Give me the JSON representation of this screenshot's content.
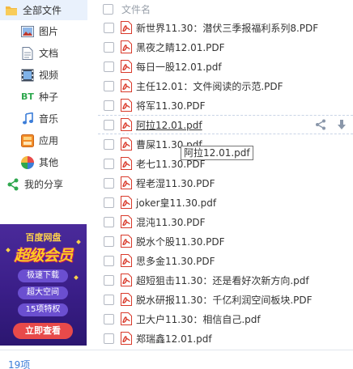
{
  "sidebar": {
    "all_files": "全部文件",
    "items": [
      {
        "label": "图片",
        "icon": "image-icon"
      },
      {
        "label": "文档",
        "icon": "document-icon"
      },
      {
        "label": "视频",
        "icon": "video-icon"
      },
      {
        "label": "种子",
        "icon": "bt-icon",
        "icon_text": "BT"
      },
      {
        "label": "音乐",
        "icon": "music-icon"
      },
      {
        "label": "应用",
        "icon": "app-icon"
      },
      {
        "label": "其他",
        "icon": "other-icon"
      }
    ],
    "share": "我的分享"
  },
  "banner": {
    "title": "百度网盘",
    "headline": "超级会员",
    "features": [
      "极速下载",
      "超大空间",
      "15项特权"
    ],
    "cta": "立即查看"
  },
  "list_header": {
    "column_label": "文件名"
  },
  "files": [
    "新世界11.30：潜伏三季报福利系列8.PDF",
    "黑夜之睛12.01.PDF",
    "每日一股12.01.pdf",
    "主任12.01：文件阅读的示范.PDF",
    "将军11.30.PDF",
    "阿拉12.01.pdf",
    "曹屎11.30.pdf",
    "老七11.30.PDF",
    "程老湿11.30.PDF",
    "joker皇11.30.pdf",
    "混沌11.30.PDF",
    "脱水个股11.30.PDF",
    "思多金11.30.PDF",
    "超短狙击11.30：还是看好次新方向.pdf",
    "脱水研报11.30：千亿利润空间板块.PDF",
    "卫大户11.30：相信自己.pdf",
    "郑瑞鑫12.01.pdf"
  ],
  "hovered_index": 5,
  "tooltip": "阿拉12.01.pdf",
  "footer": {
    "count": "19项"
  },
  "colors": {
    "accent": "#3b7dd8",
    "selected_bg": "#e9f1fc",
    "pdf_red": "#d93a2b",
    "banner_bg": "#3a1e88"
  }
}
